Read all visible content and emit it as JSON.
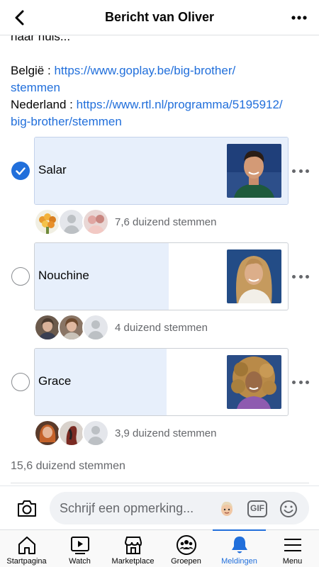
{
  "header": {
    "title": "Bericht van Oliver",
    "back_icon": "chevron-left-icon",
    "more_icon": "more-horizontal-icon"
  },
  "post": {
    "cut_line": "naar huis...",
    "belgium_label": "België : ",
    "belgium_link_line1": "https://www.goplay.be/big-brother/",
    "belgium_link_line2": "stemmen",
    "netherlands_label": "Nederland : ",
    "netherlands_link_line1": "https://www.rtl.nl/programma/5195912/",
    "netherlands_link_line2": "big-brother/stemmen"
  },
  "poll": {
    "options": [
      {
        "label": "Salar",
        "selected": true,
        "fill_fraction": 1.0,
        "votes": "7,6 duizend stemmen"
      },
      {
        "label": "Nouchine",
        "selected": false,
        "fill_fraction": 0.53,
        "votes": "4 duizend stemmen"
      },
      {
        "label": "Grace",
        "selected": false,
        "fill_fraction": 0.52,
        "votes": "3,9 duizend stemmen"
      }
    ],
    "total": "15,6 duizend stemmen"
  },
  "comment": {
    "placeholder": "Schrijf een opmerking...",
    "gif_label": "GIF"
  },
  "tabbar": {
    "tabs": [
      {
        "label": "Startpagina",
        "icon": "home-icon"
      },
      {
        "label": "Watch",
        "icon": "watch-icon"
      },
      {
        "label": "Marketplace",
        "icon": "marketplace-icon"
      },
      {
        "label": "Groepen",
        "icon": "groups-icon"
      },
      {
        "label": "Meldingen",
        "icon": "bell-icon",
        "active": true
      },
      {
        "label": "Menu",
        "icon": "menu-icon"
      }
    ]
  },
  "colors": {
    "accent": "#216fdb",
    "poll_fill": "#e7effb",
    "secondary_text": "#65676b"
  }
}
